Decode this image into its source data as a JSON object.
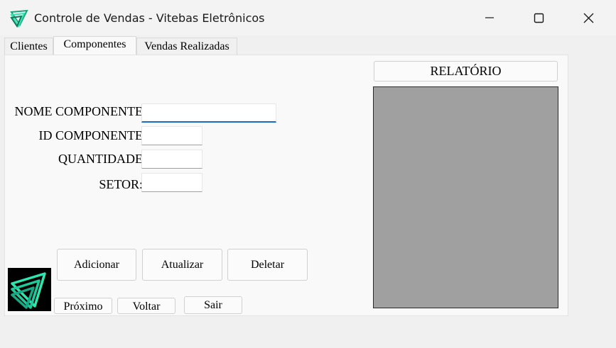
{
  "window": {
    "title": "Controle de Vendas - Vitebas Eletrônicos",
    "app_icon": "triangles-logo-icon",
    "controls": [
      "minimize-icon",
      "maximize-icon",
      "close-icon"
    ]
  },
  "tabs": [
    {
      "label": "Clientes",
      "active": false
    },
    {
      "label": "Componentes",
      "active": true
    },
    {
      "label": "Vendas Realizadas",
      "active": false
    }
  ],
  "form": {
    "nome_componente": {
      "label": "NOME COMPONENTE",
      "value": ""
    },
    "id_componente": {
      "label": "ID COMPONENTE",
      "value": ""
    },
    "quantidade": {
      "label": "QUANTIDADE",
      "value": ""
    },
    "setor": {
      "label": "SETOR:",
      "value": ""
    }
  },
  "actions": {
    "adicionar": "Adicionar",
    "atualizar": "Atualizar",
    "deletar": "Deletar",
    "proximo": "Próximo",
    "voltar": "Voltar",
    "sair": "Sair"
  },
  "report": {
    "button_label": "RELATÓRIO"
  },
  "colors": {
    "accent_teal": "#2ee6b0",
    "report_background": "#a0a0a0",
    "focus_underline": "#1a6bc2"
  }
}
